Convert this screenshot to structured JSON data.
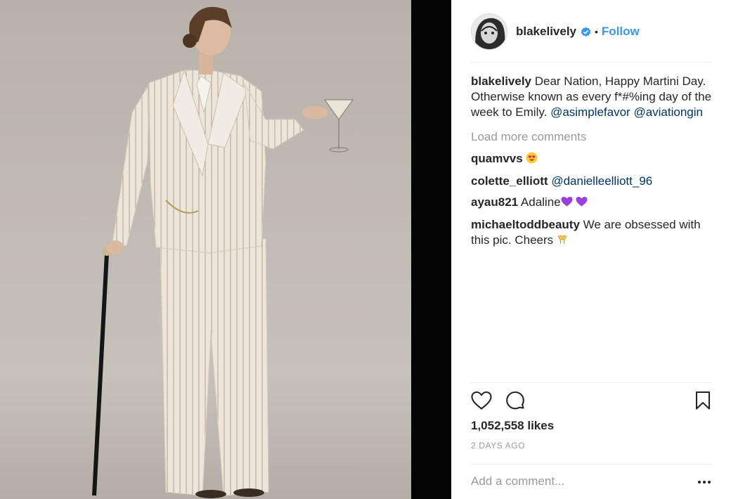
{
  "post": {
    "username": "blakelively",
    "follow_label": "Follow",
    "dot": "•",
    "image_subject": "woman-in-pinstripe-suit-with-cane-and-martini"
  },
  "caption": {
    "username": "blakelively",
    "text": " Dear Nation, Happy Martini Day. Otherwise known as every f*#%ing day of the week to Emily. ",
    "mention1": "@asimplefavor",
    "mention2": "@aviationgin"
  },
  "load_more": "Load more comments",
  "comments": [
    {
      "username": "quamvvs",
      "text": " ",
      "emoji": "heart-eyes-emoji"
    },
    {
      "username": "colette_elliott",
      "text": " ",
      "mention": "@danielleelliott_96"
    },
    {
      "username": "ayau821",
      "text": " Adaline",
      "emoji": "purple-heart-emoji"
    },
    {
      "username": "michaeltoddbeauty",
      "text": " We are obsessed with this pic. Cheers ",
      "emoji": "clinking-glasses-emoji"
    }
  ],
  "likes": "1,052,558 likes",
  "time": "2 DAYS AGO",
  "add_comment_placeholder": "Add a comment...",
  "icons": {
    "like": "heart-icon",
    "comment": "comment-bubble-icon",
    "save": "bookmark-icon",
    "more": "more-options-icon",
    "verified": "verified-badge-icon"
  },
  "colors": {
    "link": "#3897f0",
    "mention": "#003569",
    "muted": "#999999",
    "text": "#262626"
  }
}
